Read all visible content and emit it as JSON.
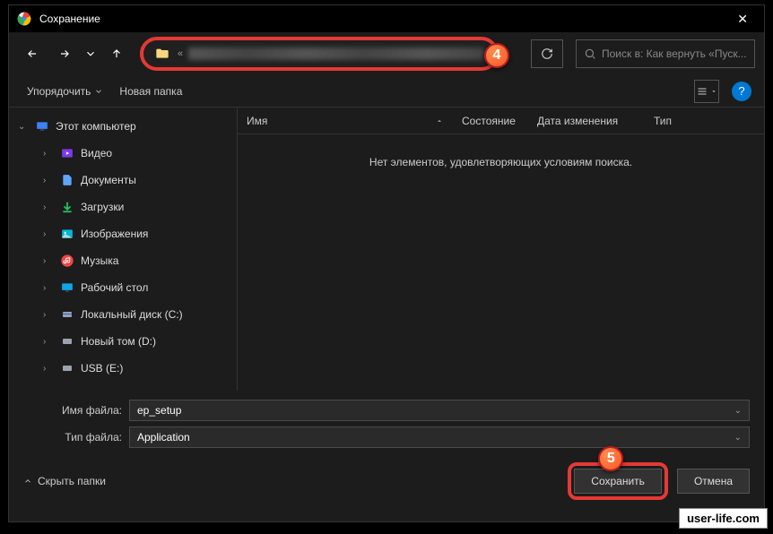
{
  "titlebar": {
    "title": "Сохранение"
  },
  "nav": {
    "path_prefix": "«",
    "search_placeholder": "Поиск в: Как вернуть «Пуск..."
  },
  "badges": {
    "b4": "4",
    "b5": "5"
  },
  "toolbar": {
    "organize": "Упорядочить",
    "new_folder": "Новая папка"
  },
  "sidebar": {
    "root": "Этот компьютер",
    "items": [
      {
        "label": "Видео"
      },
      {
        "label": "Документы"
      },
      {
        "label": "Загрузки"
      },
      {
        "label": "Изображения"
      },
      {
        "label": "Музыка"
      },
      {
        "label": "Рабочий стол"
      },
      {
        "label": "Локальный диск (C:)"
      },
      {
        "label": "Новый том (D:)"
      },
      {
        "label": "USB (E:)"
      }
    ]
  },
  "columns": {
    "name": "Имя",
    "state": "Состояние",
    "date": "Дата изменения",
    "type": "Тип"
  },
  "content": {
    "empty": "Нет элементов, удовлетворяющих условиям поиска."
  },
  "fields": {
    "filename_label": "Имя файла:",
    "filename_value": "ep_setup",
    "filetype_label": "Тип файла:",
    "filetype_value": "Application"
  },
  "footer": {
    "hide_folders": "Скрыть папки",
    "save": "Сохранить",
    "cancel": "Отмена"
  },
  "watermark": "user-life.com"
}
